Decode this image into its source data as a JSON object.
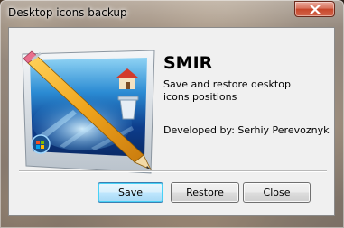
{
  "window": {
    "title": "Desktop icons backup",
    "close_icon": "close-icon"
  },
  "about": {
    "app_name": "SMIR",
    "description": "Save and restore desktop icons positions",
    "developer": "Developed by: Serhiy Perevoznyk",
    "image": "desktop-pencil-illustration"
  },
  "buttons": {
    "save_label": "Save",
    "restore_label": "Restore",
    "close_label": "Close"
  },
  "colors": {
    "close_button": "#c7462a",
    "default_button_border": "#3c7fb1",
    "client_background": "#f0f0f0"
  }
}
